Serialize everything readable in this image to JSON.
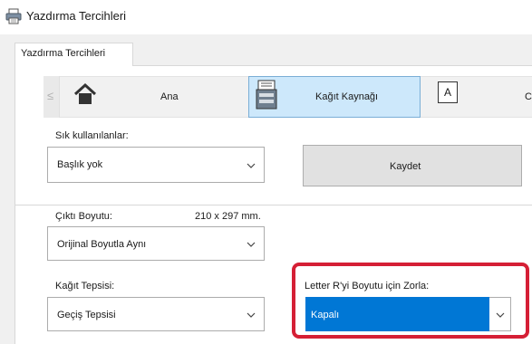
{
  "window": {
    "title": "Yazdırma Tercihleri"
  },
  "tabs": [
    {
      "label": "Yazdırma Tercihleri"
    }
  ],
  "toolbar": {
    "scroll_left": "≤",
    "items": [
      {
        "label": "Ana",
        "icon": "home-icon"
      },
      {
        "label": "Kağıt Kaynağı",
        "icon": "paper-source-icon",
        "selected": true
      },
      {
        "label": "C",
        "icon": "layout-icon",
        "glyph": "A"
      }
    ]
  },
  "favorites": {
    "label": "Sık kullanılanlar:",
    "value": "Başlık yok",
    "save_label": "Kaydet"
  },
  "output_size": {
    "label": "Çıktı Boyutu:",
    "dimensions": "210 x 297 mm.",
    "value": "Orijinal Boyutla Aynı"
  },
  "paper_tray": {
    "label": "Kağıt Tepsisi:",
    "value": "Geçiş Tepsisi"
  },
  "force_letter": {
    "label": "Letter R'yi Boyutu için Zorla:",
    "value": "Kapalı"
  },
  "colors": {
    "accent": "#0077d5",
    "highlight_frame": "#d51f35",
    "selected_tool": "#cde8fb"
  }
}
